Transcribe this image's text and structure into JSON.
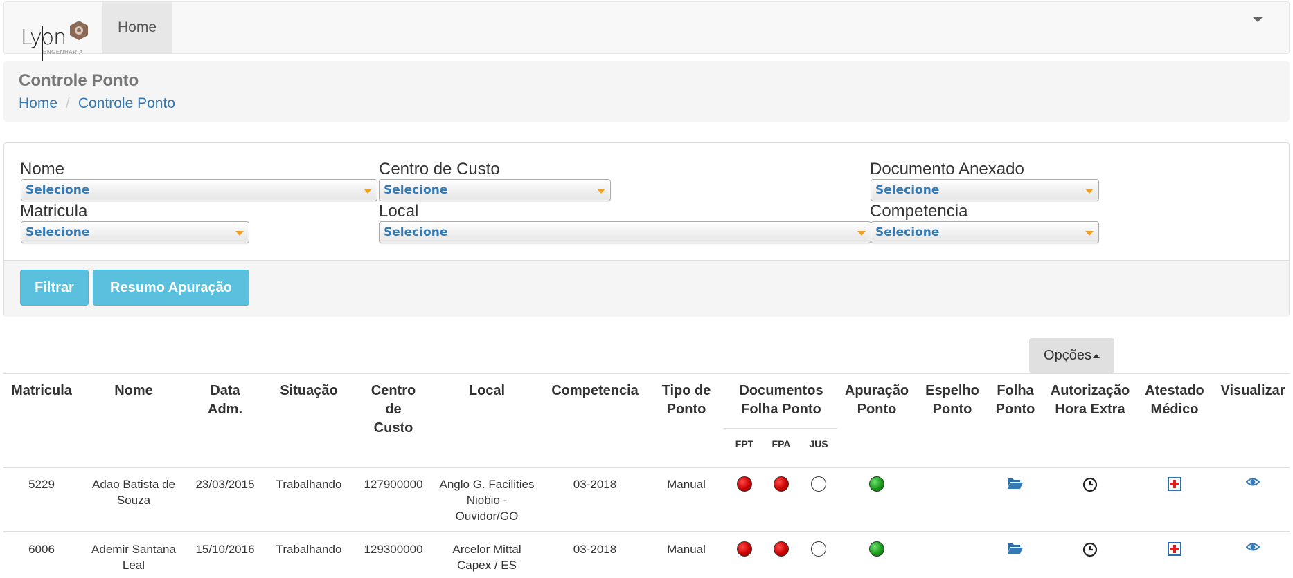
{
  "navbar": {
    "logo_text": "Lyon",
    "logo_sub": "ENGENHARIA",
    "home_label": "Home"
  },
  "header": {
    "title": "Controle Ponto",
    "breadcrumb": [
      "Home",
      "Controle Ponto"
    ]
  },
  "filters": {
    "nome": {
      "label": "Nome",
      "value": "Selecione"
    },
    "centro_custo": {
      "label": "Centro de Custo",
      "value": "Selecione"
    },
    "documento_anexado": {
      "label": "Documento Anexado",
      "value": "Selecione"
    },
    "matricula": {
      "label": "Matricula",
      "value": "Selecione"
    },
    "local": {
      "label": "Local",
      "value": "Selecione"
    },
    "competencia": {
      "label": "Competencia",
      "value": "Selecione"
    },
    "filtrar_label": "Filtrar",
    "resumo_label": "Resumo Apuração"
  },
  "opcoes_label": "Opções",
  "table": {
    "headers": {
      "matricula": "Matricula",
      "nome": "Nome",
      "data_adm": [
        "Data",
        "Adm."
      ],
      "situacao": "Situação",
      "centro_custo": [
        "Centro",
        "de",
        "Custo"
      ],
      "local": "Local",
      "competencia": "Competencia",
      "tipo_ponto": [
        "Tipo de",
        "Ponto"
      ],
      "documentos": [
        "Documentos",
        "Folha Ponto"
      ],
      "apuracao": [
        "Apuração",
        "Ponto"
      ],
      "espelho": [
        "Espelho",
        "Ponto"
      ],
      "folha": [
        "Folha",
        "Ponto"
      ],
      "autorizacao": [
        "Autorização",
        "Hora Extra"
      ],
      "atestado": [
        "Atestado",
        "Médico"
      ],
      "visualizar": "Visualizar"
    },
    "subheaders": [
      "FPT",
      "FPA",
      "JUS"
    ],
    "rows": [
      {
        "matricula": "5229",
        "nome": [
          "Adao Batista de",
          "Souza"
        ],
        "data_adm": "23/03/2015",
        "situacao": "Trabalhando",
        "centro_custo": "127900000",
        "local": [
          "Anglo G. Facilities",
          "Niobio -",
          "Ouvidor/GO"
        ],
        "competencia": "03-2018",
        "tipo_ponto": "Manual",
        "fpt": "red",
        "fpa": "red",
        "jus": "empty",
        "apuracao": "green"
      },
      {
        "matricula": "6006",
        "nome": [
          "Ademir Santana",
          "Leal"
        ],
        "data_adm": "15/10/2016",
        "situacao": "Trabalhando",
        "centro_custo": "129300000",
        "local": [
          "Arcelor Mittal",
          "Capex / ES"
        ],
        "competencia": "03-2018",
        "tipo_ponto": "Manual",
        "fpt": "red",
        "fpa": "red",
        "jus": "empty",
        "apuracao": "green"
      }
    ]
  },
  "icons": {
    "folder": "folder-open-icon",
    "clock": "clock-icon",
    "medical": "medical-cross-icon",
    "eye": "eye-icon"
  },
  "colors": {
    "link": "#337ab7",
    "button_info": "#5bc0de",
    "select_arrow": "#f0a020",
    "status_red": "#cc0000",
    "status_green": "#1a9a1a"
  }
}
